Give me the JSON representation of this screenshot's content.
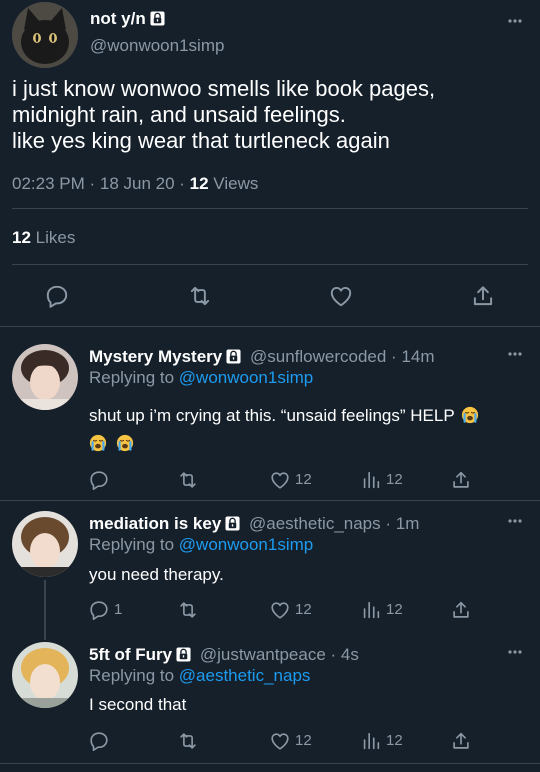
{
  "colors": {
    "background": "#15202b",
    "text": "#ffffff",
    "secondary": "#8b98a5",
    "link": "#1d9bf0",
    "divider": "#38444d"
  },
  "main_tweet": {
    "display_name": "not y/n",
    "handle": "@wonwoon1simp",
    "text_lines": [
      "i just know wonwoo smells like book pages,",
      "midnight rain, and unsaid feelings.",
      "like yes king wear that turtleneck again"
    ],
    "timestamp": "02:23 PM · 18 Jun 20 · ",
    "views_count": "12",
    "views_label": " Views",
    "likes_count": "12",
    "likes_label": " Likes",
    "actions": [
      "reply-icon",
      "retweet-icon",
      "like-icon",
      "share-icon"
    ]
  },
  "replies": [
    {
      "display_name": "Mystery Mystery",
      "handle": "@sunflowercoded · 14m",
      "replying_prefix": "Replying to ",
      "replying_to": "@wonwoon1simp",
      "text": "shut up i’m crying at this. “unsaid feelings” HELP",
      "emoji": [
        "loudly-crying-face",
        "loudly-crying-face",
        "loudly-crying-face"
      ],
      "reply_count": "",
      "like_count": "12",
      "view_count": "12"
    },
    {
      "display_name": "mediation is key",
      "handle": "@aesthetic_naps · 1m",
      "replying_prefix": "Replying to ",
      "replying_to": "@wonwoon1simp",
      "text": "you need therapy.",
      "reply_count": "1",
      "like_count": "12",
      "view_count": "12"
    },
    {
      "display_name": "5ft of Fury",
      "handle": "@justwantpeace · 4s",
      "replying_prefix": "Replying to ",
      "replying_to": "@aesthetic_naps",
      "text": "I second that",
      "reply_count": "",
      "like_count": "12",
      "view_count": "12"
    }
  ]
}
